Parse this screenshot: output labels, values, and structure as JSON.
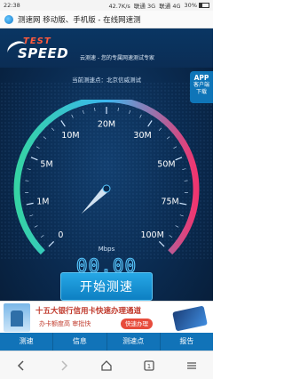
{
  "status_bar": {
    "time": "22:38",
    "speed": "42.7K/s",
    "network": "联通 3G",
    "network2": "联通 4G",
    "battery": "30%"
  },
  "browser": {
    "page_title": "测速网 移动版、手机版 - 在线网速测"
  },
  "app": {
    "logo_top": "TEST",
    "logo_bottom": "SPEED",
    "slogan": "云测速 - 您的专属网速测试专家",
    "server": "当前测速点：北京信威测试",
    "download_label_1": "APP",
    "download_label_2": "客户端",
    "download_label_3": "下载",
    "gauge": {
      "labels": [
        "0",
        "1M",
        "5M",
        "10M",
        "20M",
        "30M",
        "50M",
        "75M",
        "100M"
      ],
      "unit": "Mbps",
      "reading": "00.00",
      "accent": "#58c8ff",
      "needle_value": 0
    },
    "start_button": "开始测速"
  },
  "ad": {
    "line1": "十五大银行信用卡快速办理通道",
    "line2": "办卡额度高 审批快",
    "cta": "快速办理"
  },
  "tabs": [
    "测速",
    "信息",
    "测速点",
    "报告"
  ],
  "nav": {
    "icons": [
      "back-icon",
      "forward-icon",
      "home-icon",
      "tabs-icon",
      "menu-icon"
    ],
    "tab_count": "1"
  }
}
